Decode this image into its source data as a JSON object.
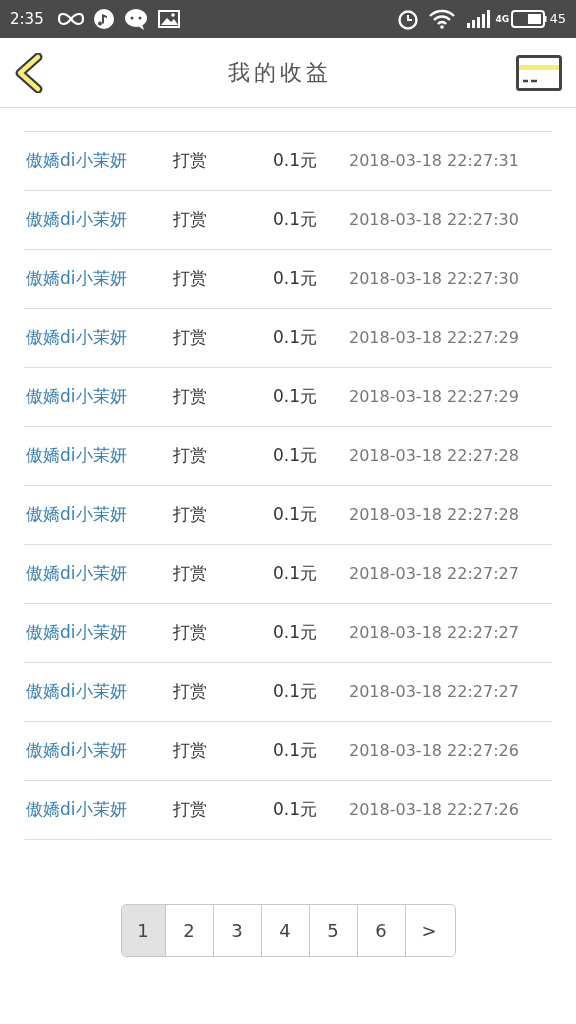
{
  "status_bar": {
    "time": "2:35",
    "network": "4G",
    "battery": "45"
  },
  "header": {
    "title": "我的收益"
  },
  "rows": [
    {
      "name": "傲嬌di小茉妍",
      "type": "打赏",
      "amount": "0.1元",
      "time": "2018-03-18 22:27:31"
    },
    {
      "name": "傲嬌di小茉妍",
      "type": "打赏",
      "amount": "0.1元",
      "time": "2018-03-18 22:27:30"
    },
    {
      "name": "傲嬌di小茉妍",
      "type": "打赏",
      "amount": "0.1元",
      "time": "2018-03-18 22:27:30"
    },
    {
      "name": "傲嬌di小茉妍",
      "type": "打赏",
      "amount": "0.1元",
      "time": "2018-03-18 22:27:29"
    },
    {
      "name": "傲嬌di小茉妍",
      "type": "打赏",
      "amount": "0.1元",
      "time": "2018-03-18 22:27:29"
    },
    {
      "name": "傲嬌di小茉妍",
      "type": "打赏",
      "amount": "0.1元",
      "time": "2018-03-18 22:27:28"
    },
    {
      "name": "傲嬌di小茉妍",
      "type": "打赏",
      "amount": "0.1元",
      "time": "2018-03-18 22:27:28"
    },
    {
      "name": "傲嬌di小茉妍",
      "type": "打赏",
      "amount": "0.1元",
      "time": "2018-03-18 22:27:27"
    },
    {
      "name": "傲嬌di小茉妍",
      "type": "打赏",
      "amount": "0.1元",
      "time": "2018-03-18 22:27:27"
    },
    {
      "name": "傲嬌di小茉妍",
      "type": "打赏",
      "amount": "0.1元",
      "time": "2018-03-18 22:27:27"
    },
    {
      "name": "傲嬌di小茉妍",
      "type": "打赏",
      "amount": "0.1元",
      "time": "2018-03-18 22:27:26"
    },
    {
      "name": "傲嬌di小茉妍",
      "type": "打赏",
      "amount": "0.1元",
      "time": "2018-03-18 22:27:26"
    }
  ],
  "pagination": [
    {
      "label": "1",
      "selected": true
    },
    {
      "label": "2",
      "selected": false
    },
    {
      "label": "3",
      "selected": false
    },
    {
      "label": "4",
      "selected": false
    },
    {
      "label": "5",
      "selected": false
    },
    {
      "label": "6",
      "selected": false
    },
    {
      "label": ">",
      "selected": false
    }
  ]
}
